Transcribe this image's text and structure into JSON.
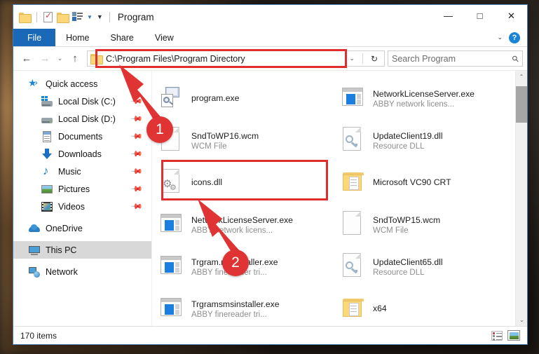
{
  "window": {
    "title": "Program",
    "quick_access": [
      {
        "name": "folder-icon",
        "label": ""
      },
      {
        "name": "properties-icon",
        "label": ""
      },
      {
        "name": "new-folder-icon",
        "label": ""
      },
      {
        "name": "view-options-icon",
        "label": ""
      },
      {
        "name": "customize-toolbar-icon",
        "label": ""
      }
    ],
    "controls": {
      "minimize": "—",
      "maximize": "□",
      "close": "✕",
      "ribbon_expand": "⌄",
      "help": "?"
    }
  },
  "ribbon": {
    "tabs": [
      {
        "label": "File",
        "selected": true
      },
      {
        "label": "Home",
        "selected": false
      },
      {
        "label": "Share",
        "selected": false
      },
      {
        "label": "View",
        "selected": false
      }
    ]
  },
  "address_bar": {
    "back": "←",
    "forward": "→",
    "recent": "⌄",
    "up": "↑",
    "path": "C:\\Program Files\\Program Directory",
    "dropdown": "⌄",
    "refresh": "↻"
  },
  "search": {
    "placeholder": "Search Program",
    "icon": "search-icon"
  },
  "sidebar": {
    "items": [
      {
        "label": "Quick access",
        "icon": "quick-access-star-icon",
        "indent": false,
        "pinned": false,
        "selected": false
      },
      {
        "label": "Local Disk (C:)",
        "icon": "local-disk-c-icon",
        "indent": true,
        "pinned": true,
        "selected": false
      },
      {
        "label": "Local Disk (D:)",
        "icon": "local-disk-d-icon",
        "indent": true,
        "pinned": true,
        "selected": false
      },
      {
        "label": "Documents",
        "icon": "documents-icon",
        "indent": true,
        "pinned": true,
        "selected": false
      },
      {
        "label": "Downloads",
        "icon": "downloads-icon",
        "indent": true,
        "pinned": true,
        "selected": false
      },
      {
        "label": "Music",
        "icon": "music-icon",
        "indent": true,
        "pinned": true,
        "selected": false
      },
      {
        "label": "Pictures",
        "icon": "pictures-icon",
        "indent": true,
        "pinned": true,
        "selected": false
      },
      {
        "label": "Videos",
        "icon": "videos-icon",
        "indent": true,
        "pinned": true,
        "selected": false
      },
      {
        "label": "OneDrive",
        "icon": "onedrive-icon",
        "indent": false,
        "pinned": false,
        "selected": false
      },
      {
        "label": "This PC",
        "icon": "this-pc-icon",
        "indent": false,
        "pinned": false,
        "selected": true
      },
      {
        "label": "Network",
        "icon": "network-icon",
        "indent": false,
        "pinned": false,
        "selected": false
      }
    ]
  },
  "files": [
    {
      "name": "program.exe",
      "sub": "",
      "icon": "program-exe-icon",
      "highlighted": false
    },
    {
      "name": "NetworkLicenseServer.exe",
      "sub": "ABBY network licens...",
      "icon": "exe-icon",
      "highlighted": false
    },
    {
      "name": "SndToWP16.wcm",
      "sub": "WCM File",
      "icon": "blank-page-icon",
      "highlighted": false
    },
    {
      "name": "UpdateClient19.dll",
      "sub": "Resource DLL",
      "icon": "resource-dll-icon",
      "highlighted": false
    },
    {
      "name": "icons.dll",
      "sub": "",
      "icon": "gear-dll-icon",
      "highlighted": true
    },
    {
      "name": "Microsoft VC90 CRT",
      "sub": "",
      "icon": "folder-icon",
      "highlighted": false
    },
    {
      "name": "NetworkLicenseServer.exe",
      "sub": "ABBY network licens...",
      "icon": "exe-icon",
      "highlighted": false
    },
    {
      "name": "SndToWP15.wcm",
      "sub": "WCM File",
      "icon": "blank-page-icon",
      "highlighted": false
    },
    {
      "name": "Trgram.msInstaller.exe",
      "sub": "ABBY finereader tri...",
      "icon": "exe-icon",
      "highlighted": false
    },
    {
      "name": "UpdateClient65.dll",
      "sub": "Resource DLL",
      "icon": "resource-dll-icon",
      "highlighted": false
    },
    {
      "name": "Trgramsmsinstaller.exe",
      "sub": "ABBY finereader tri...",
      "icon": "exe-icon",
      "highlighted": false
    },
    {
      "name": "x64",
      "sub": "",
      "icon": "folder-icon",
      "highlighted": false
    }
  ],
  "status_bar": {
    "item_count": "170 items",
    "view_details_icon": "details-view-icon",
    "view_large_icons_icon": "large-icons-view-icon"
  },
  "annotations": {
    "accent_color": "#e02d2d",
    "markers": [
      {
        "number": "1",
        "points_to": "address-bar"
      },
      {
        "number": "2",
        "points_to": "icons-dll-file"
      }
    ]
  },
  "scrollbar": {
    "up_arrow": "⌃",
    "down_arrow": "⌄"
  }
}
